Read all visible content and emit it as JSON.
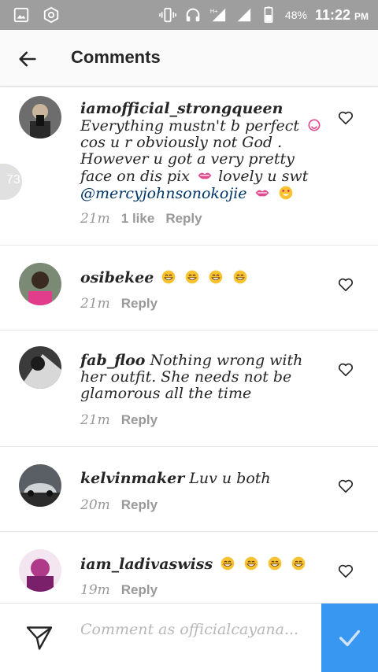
{
  "status_bar": {
    "icons_left": [
      "gallery-icon",
      "settings-icon"
    ],
    "icons_right": [
      "vibrate-icon",
      "headset-icon",
      "signal-hplus-icon",
      "signal-icon",
      "battery-icon"
    ],
    "network": "H+",
    "battery": "48%",
    "time": "11:22",
    "ampm": "PM"
  },
  "app_bar": {
    "title": "Comments"
  },
  "side_badge": {
    "value": "73"
  },
  "comments": [
    {
      "username": "iamofficial_strongqueen",
      "text_line1": "Everything mustn't b perfect",
      "text_rest": "cos u r obviously not God . However u got a very pretty face on dis pix",
      "text_after": "lovely u swt",
      "mention": "@mercyjohnsonokojie",
      "time": "21m",
      "likes": "1 like",
      "reply": "Reply"
    },
    {
      "username": "osibekee",
      "text": "",
      "emojis": 4,
      "time": "21m",
      "reply": "Reply"
    },
    {
      "username": "fab_floo",
      "text": "Nothing wrong with her outfit. She needs not be glamorous all the time",
      "time": "21m",
      "reply": "Reply"
    },
    {
      "username": "kelvinmaker",
      "text": "Luv u both",
      "time": "20m",
      "reply": "Reply"
    },
    {
      "username": "iam_ladivaswiss",
      "text": "",
      "emojis": 4,
      "time": "19m",
      "reply": "Reply"
    }
  ],
  "comment_bar": {
    "placeholder": "Comment as officialcayana..."
  },
  "colors": {
    "status_bar": "#9e9e9e",
    "accent": "#3897f0",
    "meta": "#999999",
    "mention": "#003569"
  }
}
